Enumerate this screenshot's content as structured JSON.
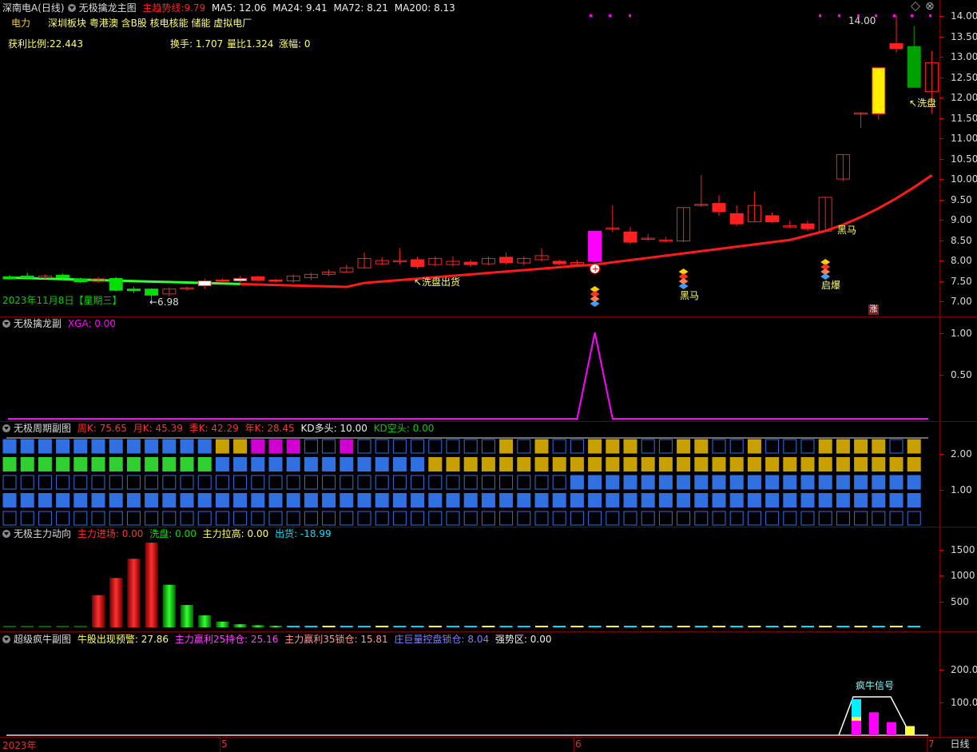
{
  "main": {
    "stock_title": "深南电A(日线)",
    "indicator_name": "无极擒龙主图",
    "trend_label": "主趋势线:",
    "trend_value": "9.79",
    "ma5": "MA5: 12.06",
    "ma24": "MA24: 9.41",
    "ma72": "MA72: 8.21",
    "ma200": "MA200: 8.13",
    "sector_name": "电力",
    "concepts": "深圳板块  粤港澳 含B股 核电核能 储能 虚拟电厂",
    "profit_ratio": "获利比例:22.443",
    "turnover": "换手: 1.707",
    "volume_ratio": "量比1.324",
    "change": "涨幅: 0",
    "date_label": "2023年11月8日【星期三】",
    "low_price_label": "←6.98",
    "high_price_label": "14.00",
    "annotations": {
      "wash_out": "↖洗盘出货",
      "wash": "↖洗盘",
      "dark_horse": "黑马",
      "dark_horse2": "黑马",
      "explode": "启爆",
      "limit_up": "涨"
    },
    "y_ticks": [
      "14.00",
      "13.50",
      "13.00",
      "12.50",
      "12.00",
      "11.50",
      "11.00",
      "10.50",
      "10.00",
      "9.50",
      "9.00",
      "8.50",
      "8.00",
      "7.50",
      "7.00"
    ],
    "colors": {
      "up": "#ff2020",
      "down": "#00d000",
      "trend": "#ff1a1a",
      "accent": "#ff00ff"
    }
  },
  "panel_xga": {
    "name": "无极擒龙副",
    "value_label": "XGA: 0.00",
    "y_ticks": [
      "1.00",
      "0.50"
    ]
  },
  "panel_cycle": {
    "name": "无极周期副图",
    "week_k": "周K: 75.65",
    "month_k": "月K: 45.39",
    "season_k": "季K: 42.29",
    "year_k": "年K: 28.45",
    "kd_long": "KD多头: 10.00",
    "kd_short": "KD空头: 0.00",
    "y_ticks": [
      "2.00",
      "1.00"
    ]
  },
  "panel_force": {
    "name": "无极主力动向",
    "enter": "主力进场: 0.00",
    "wash": "洗盘: 0.00",
    "pull": "主力拉高: 0.00",
    "ship": "出货: -18.99",
    "y_ticks": [
      "1500",
      "1000",
      "500"
    ]
  },
  "panel_bull": {
    "name": "超级疯牛副图",
    "warn": "牛股出现预警: 27.86",
    "profit25": "主力赢利25持仓: 25.16",
    "profit35": "主力赢利35锁仓: 15.81",
    "control": "庄巨量控盘锁仓: 8.04",
    "strong": "强势区: 0.00",
    "signal": "疯牛信号",
    "y_ticks": [
      "200.0",
      "100.0"
    ]
  },
  "timeline": {
    "year": "2023年",
    "m5": "5",
    "m6": "6",
    "m7": "7",
    "period_button": "日线"
  },
  "chart_data": {
    "type": "candlestick",
    "ohlc": [
      [
        7.6,
        7.55,
        7.53,
        7.65
      ],
      [
        7.62,
        7.58,
        7.53,
        7.7
      ],
      [
        7.58,
        7.62,
        7.55,
        7.66
      ],
      [
        7.64,
        7.58,
        7.53,
        7.68
      ],
      [
        7.55,
        7.48,
        7.45,
        7.58
      ],
      [
        7.49,
        7.55,
        7.45,
        7.6
      ],
      [
        7.56,
        7.27,
        7.24,
        7.6
      ],
      [
        7.3,
        7.26,
        7.2,
        7.36
      ],
      [
        7.3,
        7.15,
        6.98,
        7.32
      ],
      [
        7.18,
        7.3,
        7.12,
        7.34
      ],
      [
        7.32,
        7.33,
        7.26,
        7.36
      ],
      [
        7.38,
        7.5,
        7.3,
        7.56
      ],
      [
        7.52,
        7.5,
        7.45,
        7.56
      ],
      [
        7.5,
        7.56,
        7.45,
        7.62
      ],
      [
        7.6,
        7.52,
        7.48,
        7.62
      ],
      [
        7.52,
        7.5,
        7.45,
        7.55
      ],
      [
        7.5,
        7.62,
        7.45,
        7.66
      ],
      [
        7.58,
        7.66,
        7.52,
        7.7
      ],
      [
        7.66,
        7.72,
        7.62,
        7.78
      ],
      [
        7.72,
        7.82,
        7.7,
        7.9
      ],
      [
        7.82,
        8.05,
        7.8,
        8.2
      ],
      [
        7.92,
        8.0,
        7.88,
        8.08
      ],
      [
        7.98,
        8.0,
        7.9,
        8.3
      ],
      [
        8.02,
        7.85,
        7.8,
        8.1
      ],
      [
        7.9,
        8.05,
        7.86,
        8.1
      ],
      [
        7.9,
        7.98,
        7.85,
        8.1
      ],
      [
        7.96,
        7.9,
        7.84,
        8.02
      ],
      [
        7.92,
        8.05,
        7.88,
        8.1
      ],
      [
        8.08,
        7.95,
        7.9,
        8.2
      ],
      [
        7.94,
        8.05,
        7.88,
        8.1
      ],
      [
        8.02,
        8.12,
        7.98,
        8.3
      ],
      [
        7.98,
        7.92,
        7.88,
        8.02
      ],
      [
        7.9,
        7.95,
        7.88,
        8.02
      ],
      [
        7.98,
        8.72,
        7.95,
        8.72
      ],
      [
        8.78,
        8.8,
        8.7,
        9.35
      ],
      [
        8.7,
        8.45,
        8.4,
        8.82
      ],
      [
        8.52,
        8.55,
        8.48,
        8.65
      ],
      [
        8.48,
        8.5,
        8.45,
        8.58
      ],
      [
        8.48,
        9.3,
        8.45,
        9.3
      ],
      [
        9.35,
        9.38,
        9.32,
        10.1
      ],
      [
        9.4,
        9.2,
        9.1,
        9.6
      ],
      [
        9.15,
        8.9,
        8.85,
        9.35
      ],
      [
        8.95,
        9.35,
        8.95,
        9.7
      ],
      [
        9.1,
        8.95,
        8.92,
        9.18
      ],
      [
        8.85,
        8.85,
        8.8,
        8.98
      ],
      [
        8.9,
        8.78,
        8.72,
        8.98
      ],
      [
        8.72,
        9.55,
        8.72,
        9.55
      ],
      [
        10.0,
        10.6,
        9.95,
        10.6
      ],
      [
        11.6,
        11.62,
        11.25,
        11.65
      ],
      [
        11.6,
        12.73,
        11.45,
        12.73
      ],
      [
        13.32,
        13.2,
        13.1,
        14.0
      ],
      [
        13.25,
        12.25,
        12.25,
        13.75
      ],
      [
        12.15,
        12.85,
        11.6,
        13.15
      ]
    ],
    "trend_line": "MA trend (red) rising from ~7.45 to ~10.10",
    "xga": "spike to 1.00 at the 34th bar, 0 elsewhere",
    "force_bars": [
      5,
      5,
      5,
      5,
      5,
      620,
      950,
      1320,
      1630,
      820,
      430,
      230,
      110,
      60,
      40,
      20,
      15,
      12,
      10,
      8,
      8,
      8,
      8,
      8,
      8,
      8,
      8,
      8,
      8,
      8,
      8,
      8,
      8,
      8,
      8,
      8,
      8,
      8,
      8,
      8,
      8,
      8,
      8,
      8,
      8,
      8,
      8,
      8,
      8,
      8,
      8,
      8
    ],
    "bull_bars": [
      0,
      0,
      0,
      0,
      0,
      0,
      0,
      0,
      0,
      0,
      0,
      0,
      0,
      0,
      0,
      0,
      0,
      0,
      0,
      0,
      0,
      0,
      0,
      0,
      0,
      0,
      0,
      0,
      0,
      0,
      0,
      0,
      0,
      0,
      0,
      0,
      0,
      0,
      0,
      0,
      0,
      0,
      0,
      0,
      0,
      0,
      0,
      0,
      110,
      70,
      40,
      27.86
    ]
  }
}
